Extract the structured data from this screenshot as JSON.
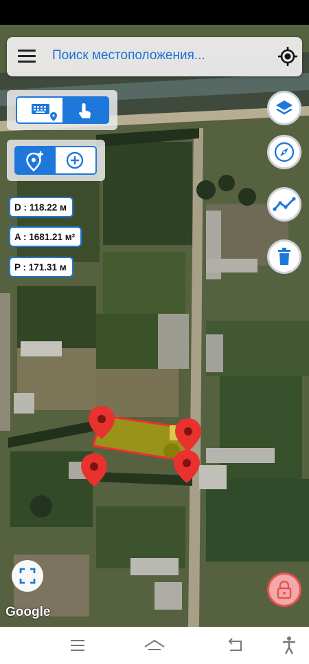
{
  "search": {
    "placeholder": "Поиск местоположения..."
  },
  "measurements": {
    "distance": "D : 118.22 м",
    "area": "A : 1681.21 м²",
    "perimeter": "P : 171.31 м"
  },
  "map": {
    "attribution": "Google"
  },
  "colors": {
    "accent": "#1e78dc",
    "marker": "#e8322e",
    "polygon_fill": "#c8b400",
    "lock": "#e95050"
  },
  "icons": {
    "menu": "menu-icon",
    "locate": "my-location-icon",
    "keyboard": "keyboard-icon",
    "touch": "touch-icon",
    "add_marker": "add-location-icon",
    "add_point": "add-circle-icon",
    "layers": "layers-icon",
    "compass": "compass-icon",
    "polyline": "polyline-icon",
    "delete": "trash-icon",
    "fullscreen": "fullscreen-icon",
    "lock": "lock-icon"
  }
}
